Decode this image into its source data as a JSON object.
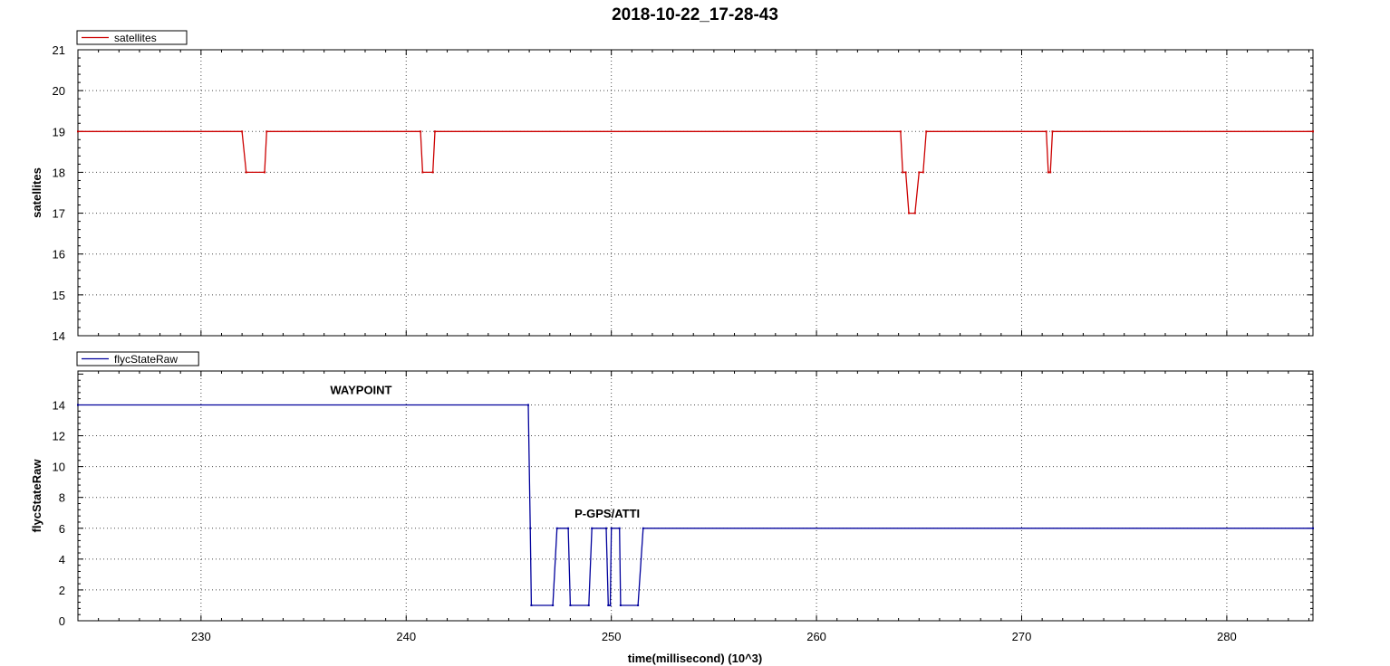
{
  "title": "2018-10-22_17-28-43",
  "xlabel": "time(millisecond) (10^3)",
  "chart_data": [
    {
      "type": "line",
      "ylabel": "satellites",
      "legend": "satellites",
      "legend_position": "top-left",
      "color": "#cc0000",
      "grid": true,
      "xlim": [
        224,
        284.2
      ],
      "ylim": [
        14,
        21
      ],
      "xticks": [
        230,
        240,
        250,
        260,
        270,
        280
      ],
      "yticks": [
        14,
        15,
        16,
        17,
        18,
        19,
        20,
        21
      ],
      "series": [
        {
          "name": "satellites",
          "x": [
            224,
            232.0,
            232.2,
            233.1,
            233.2,
            240.7,
            240.8,
            241.3,
            241.4,
            264.1,
            264.2,
            264.35,
            264.5,
            264.8,
            265.0,
            265.2,
            265.35,
            271.2,
            271.3,
            271.4,
            271.5,
            284.2
          ],
          "y": [
            19,
            19,
            18,
            18,
            19,
            19,
            18,
            18,
            19,
            19,
            18,
            18,
            17,
            17,
            18,
            18,
            19,
            19,
            18,
            18,
            19,
            19
          ]
        }
      ]
    },
    {
      "type": "line",
      "ylabel": "flycStateRaw",
      "legend": "flycStateRaw",
      "legend_position": "top-left",
      "color": "#00009c",
      "grid": true,
      "xlim": [
        224,
        284.2
      ],
      "ylim": [
        0,
        16.2
      ],
      "xticks": [
        230,
        240,
        250,
        260,
        270,
        280
      ],
      "yticks": [
        0,
        2,
        4,
        6,
        8,
        10,
        12,
        14
      ],
      "series": [
        {
          "name": "flycStateRaw",
          "x": [
            224,
            245.95,
            246.05,
            246.1,
            247.15,
            247.35,
            247.9,
            248.0,
            248.9,
            249.05,
            249.75,
            249.85,
            249.95,
            250.0,
            250.4,
            250.45,
            251.3,
            251.55,
            284.2
          ],
          "y": [
            14,
            14,
            6,
            1,
            1,
            6,
            6,
            1,
            1,
            6,
            6,
            1,
            1,
            6,
            6,
            1,
            1,
            6,
            6
          ]
        }
      ],
      "annotations": [
        {
          "text": "WAYPOINT",
          "x": 237.8,
          "y": 14.7
        },
        {
          "text": "P-GPS/ATTI",
          "x": 249.8,
          "y": 6.7
        }
      ]
    }
  ]
}
